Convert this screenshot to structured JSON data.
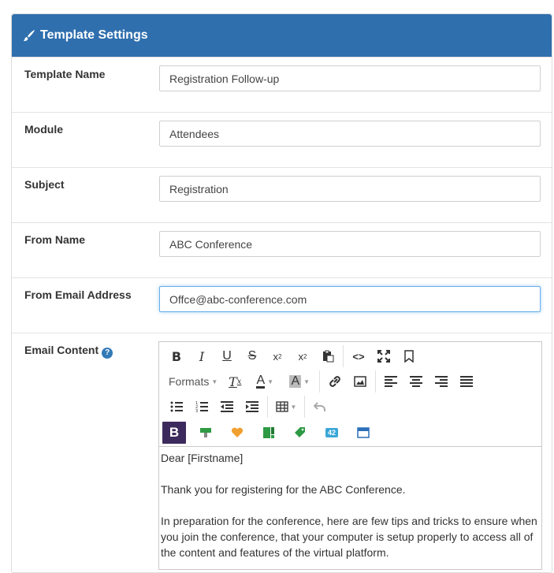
{
  "header": {
    "title": "Template Settings",
    "icon": "paint-brush-icon"
  },
  "fields": [
    {
      "label": "Template Name",
      "value": "Registration Follow-up"
    },
    {
      "label": "Module",
      "value": "Attendees"
    },
    {
      "label": "Subject",
      "value": "Registration"
    },
    {
      "label": "From Name",
      "value": "ABC Conference"
    },
    {
      "label": "From Email Address",
      "value": "Offce@abc-conference.com"
    }
  ],
  "email_content": {
    "label": "Email Content",
    "help": "?",
    "toolbar": {
      "formats_label": "Formats",
      "row1": [
        "bold-icon",
        "italic-icon",
        "underline-icon",
        "strikethrough-icon",
        "superscript-icon",
        "subscript-icon",
        "paste-icon",
        "code-icon",
        "fullscreen-icon",
        "bookmark-icon"
      ],
      "row2": [
        "formats-dropdown",
        "clear-formatting-icon",
        "text-color-icon",
        "background-color-icon",
        "link-icon",
        "image-icon",
        "align-left-icon",
        "align-center-icon",
        "align-right-icon",
        "align-justify-icon"
      ],
      "row3": [
        "bullet-list-icon",
        "numbered-list-icon",
        "outdent-icon",
        "indent-icon",
        "table-icon",
        "undo-icon"
      ],
      "row4": [
        "bold-plugin-icon",
        "merge-field-icon",
        "heart-icon",
        "layout-icon",
        "tag-icon",
        "number-badge-icon",
        "window-icon"
      ],
      "badge_number": "42"
    },
    "body": [
      "Dear [Firstname]",
      "Thank you for registering for the ABC Conference.",
      "In preparation for the conference, here are few tips and tricks to ensure when you join the conference, that your computer is setup properly to access all of the content and features of the virtual platform."
    ]
  },
  "colors": {
    "header_bg": "#2f6fae",
    "focus_border": "#66afe9",
    "help_icon": "#337ab7"
  }
}
